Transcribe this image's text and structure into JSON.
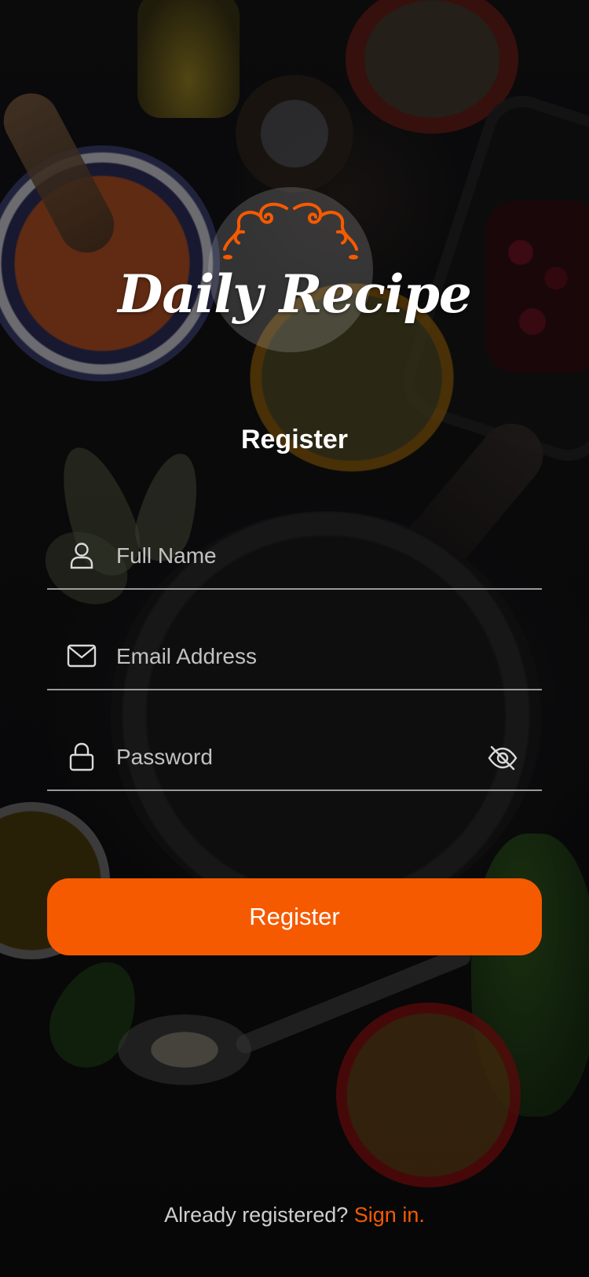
{
  "app": {
    "logo_text": "Daily Recipe"
  },
  "page": {
    "title": "Register"
  },
  "form": {
    "full_name": {
      "value": "",
      "placeholder": "Full Name",
      "icon": "person-icon"
    },
    "email": {
      "value": "",
      "placeholder": "Email Address",
      "icon": "mail-icon"
    },
    "password": {
      "value": "",
      "placeholder": "Password",
      "icon": "lock-icon",
      "toggle_icon": "eye-off-icon"
    },
    "submit_label": "Register"
  },
  "footer": {
    "prompt": "Already registered? ",
    "link": "Sign in."
  },
  "colors": {
    "accent": "#f65a00",
    "text": "#ffffff",
    "underline": "#bebebe"
  }
}
